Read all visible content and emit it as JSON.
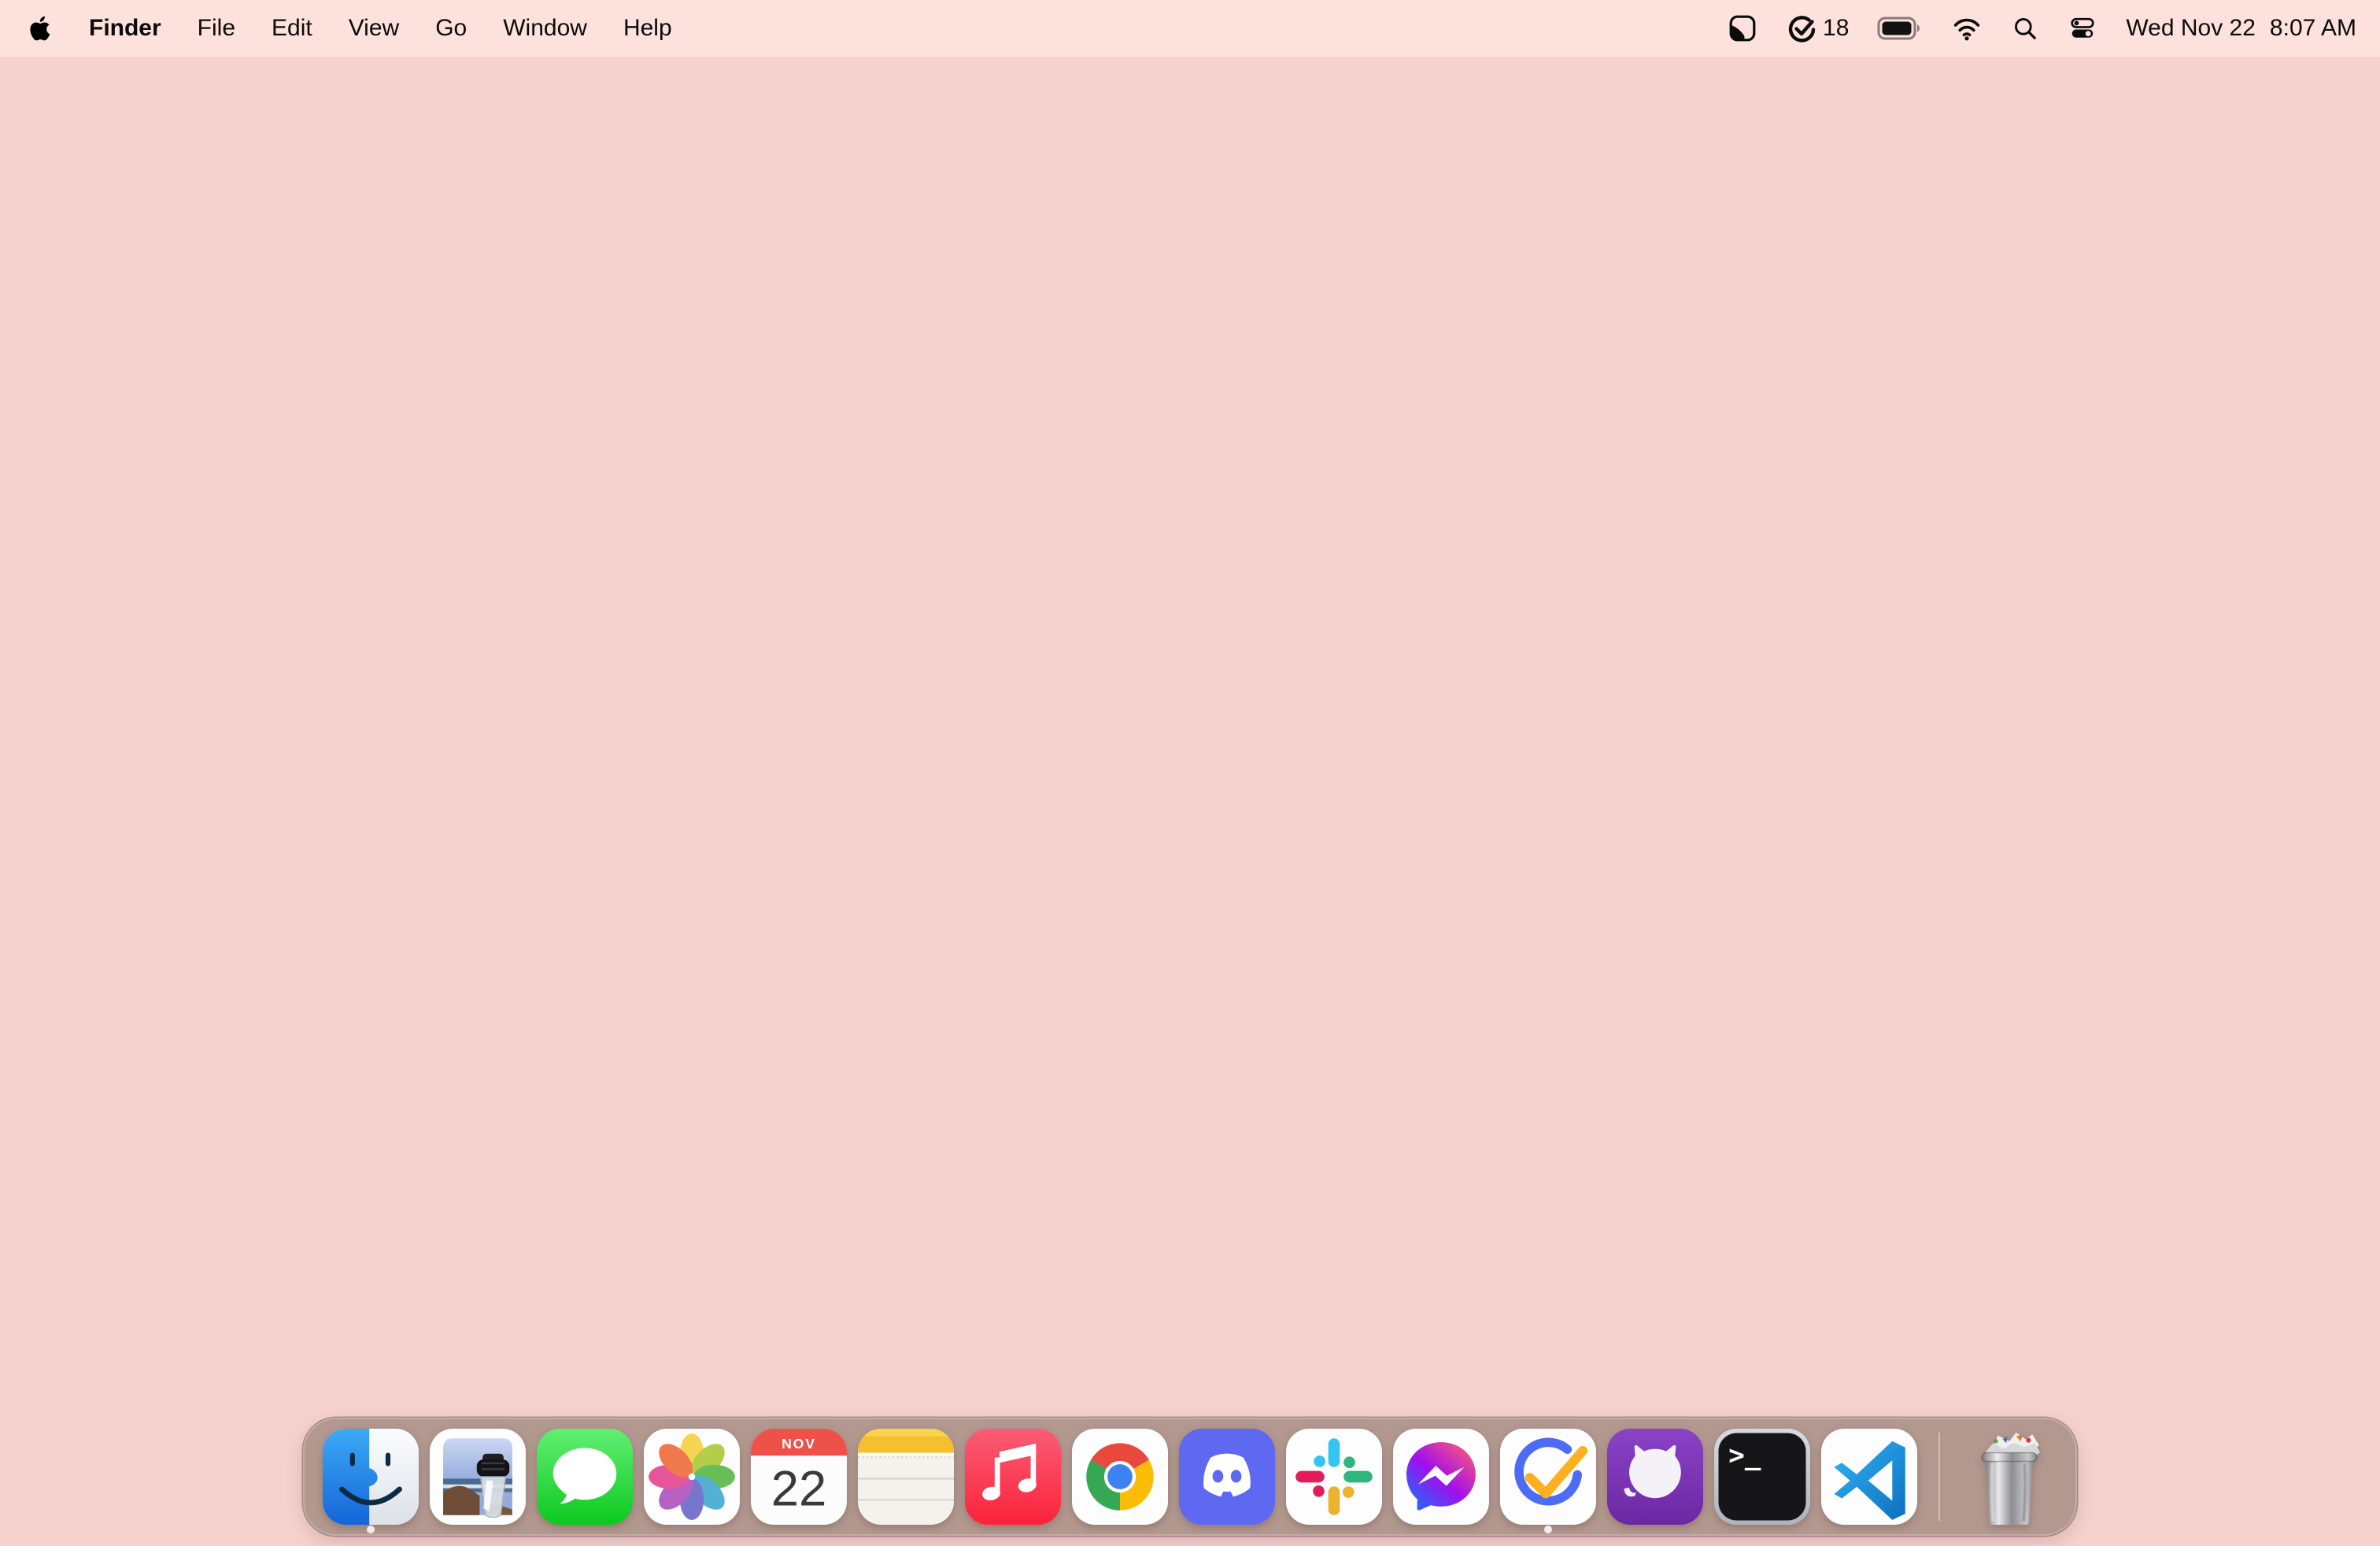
{
  "colors": {
    "desktop_bg": "#F6D2CE",
    "menu_bar_bg": "#FCE1DD",
    "dock_bg": "#B2988F",
    "ticktick_blue": "#4D6BF5",
    "ticktick_check": "#FFB020",
    "calendar_red": "#EE5147",
    "notes_yellow": "#F8C93B",
    "music_red": "#FA3B50",
    "discord_blurple": "#5E68F0",
    "github_purple": "#7D36B9"
  },
  "menu_bar": {
    "menus": [
      "Finder",
      "File",
      "Edit",
      "View",
      "Go",
      "Window",
      "Help"
    ],
    "status_icons": [
      "screen-capture",
      "ticktick-task-ring",
      "battery",
      "wifi",
      "spotlight-search",
      "control-center"
    ],
    "task_count": "18",
    "date": "Wed Nov 22",
    "time": "8:07 AM"
  },
  "dock": {
    "items": [
      {
        "label": "Finder",
        "running": true
      },
      {
        "label": "Preview",
        "running": false
      },
      {
        "label": "Messages",
        "running": false
      },
      {
        "label": "Photos",
        "running": false
      },
      {
        "label": "Calendar",
        "running": false,
        "month": "NOV",
        "day": "22"
      },
      {
        "label": "Notes",
        "running": false
      },
      {
        "label": "Music",
        "running": false
      },
      {
        "label": "Google Chrome",
        "running": false
      },
      {
        "label": "Discord",
        "running": false
      },
      {
        "label": "Slack",
        "running": false
      },
      {
        "label": "Messenger",
        "running": false
      },
      {
        "label": "TickTick",
        "running": true
      },
      {
        "label": "GitHub Desktop",
        "running": false
      },
      {
        "label": "Terminal",
        "running": false,
        "prompt": ">_"
      },
      {
        "label": "Visual Studio Code",
        "running": false
      }
    ],
    "trash_label": "Trash"
  }
}
